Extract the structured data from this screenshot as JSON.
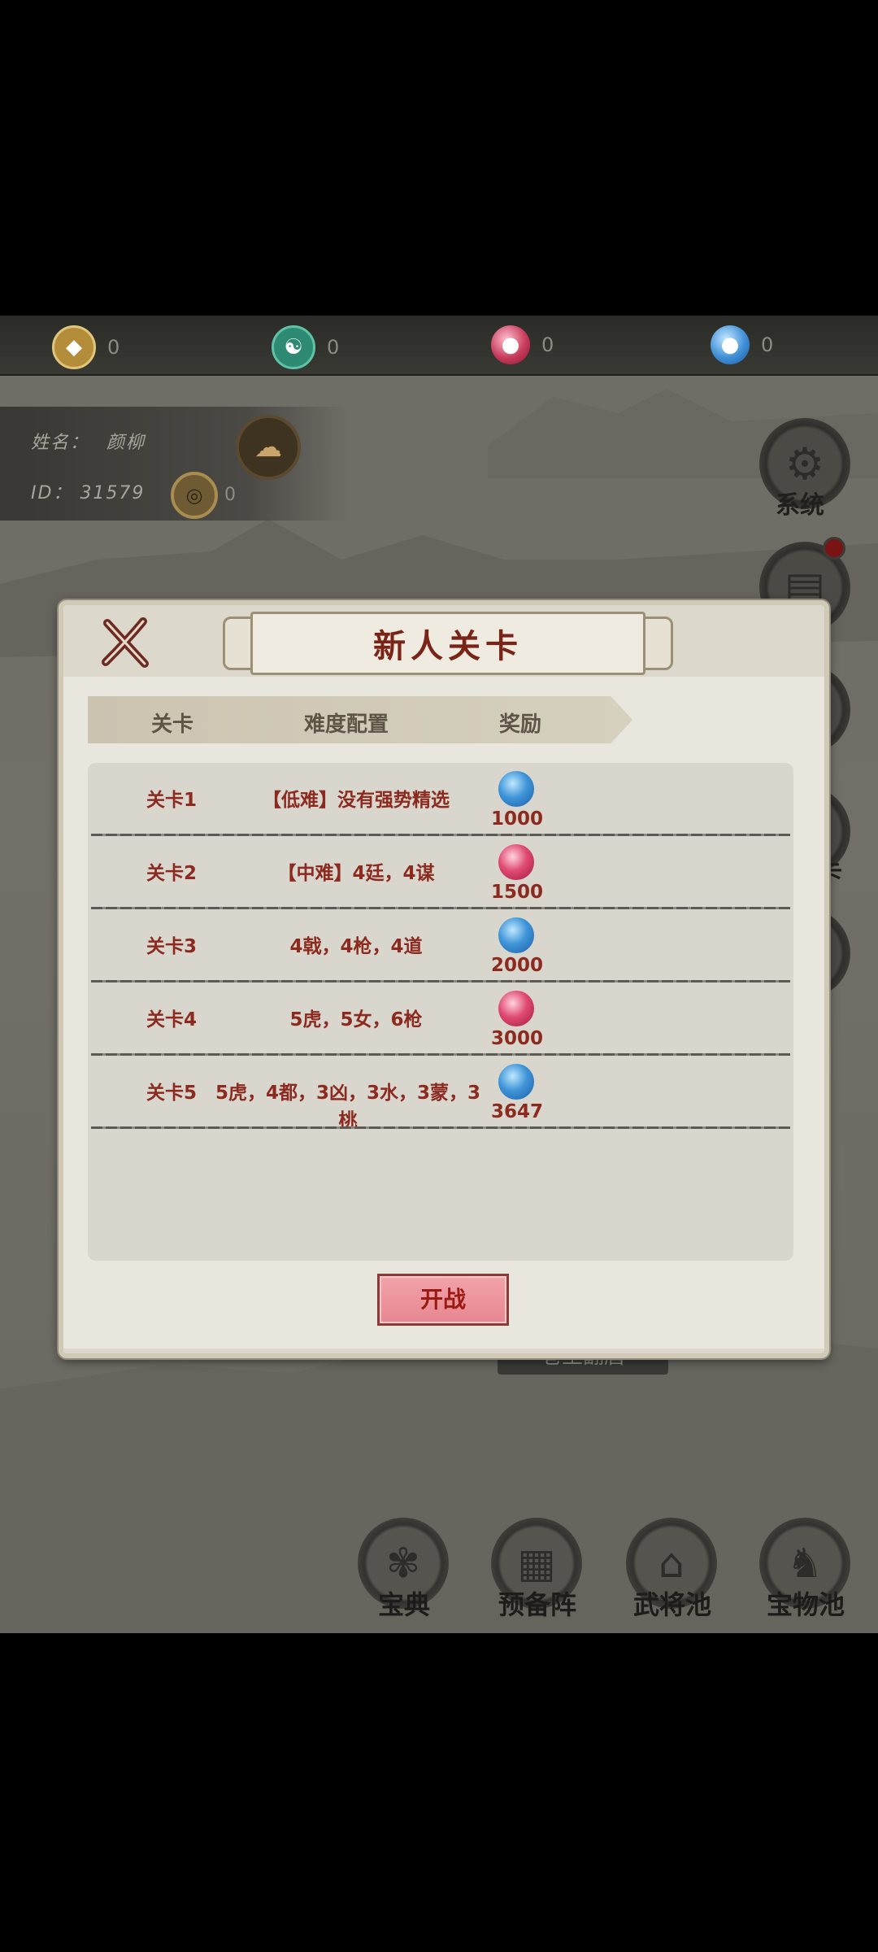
{
  "resources": [
    {
      "icon": "coin-icon",
      "value": "0",
      "color": "#caa44e"
    },
    {
      "icon": "jade-dragon-icon",
      "value": "0",
      "color": "#3e9c84"
    },
    {
      "icon": "red-orb-icon",
      "value": "0",
      "color": "#c83b5c"
    },
    {
      "icon": "blue-orb-icon",
      "value": "0",
      "color": "#3f8fd6"
    }
  ],
  "profile": {
    "name_label": "姓名：",
    "name_value": "颜柳",
    "id_label": "ID：",
    "id_value": "31579",
    "currency_value": "0"
  },
  "side_menu": [
    {
      "label": "系统",
      "icon": "gear-icon"
    },
    {
      "label": "",
      "icon": "scroll-icon"
    },
    {
      "label": "",
      "icon": "book-icon"
    },
    {
      "label": "卡",
      "icon": "card-icon"
    },
    {
      "label": "",
      "icon": "badge-icon"
    }
  ],
  "behind_banner": "巷王翻唐",
  "bottom_nav": [
    {
      "label": "宝典",
      "icon": "fan-icon"
    },
    {
      "label": "预备阵",
      "icon": "grid-icon"
    },
    {
      "label": "武将池",
      "icon": "pavilion-icon"
    },
    {
      "label": "宝物池",
      "icon": "dragon-icon"
    }
  ],
  "modal": {
    "title": "新人关卡",
    "headers": {
      "stage": "关卡",
      "config": "难度配置",
      "reward": "奖励"
    },
    "rows": [
      {
        "stage": "关卡1",
        "config": "【低难】没有强势精选",
        "reward_type": "blue",
        "reward": "1000"
      },
      {
        "stage": "关卡2",
        "config": "【中难】4廷，4谋",
        "reward_type": "red",
        "reward": "1500"
      },
      {
        "stage": "关卡3",
        "config": "4戟，4枪，4道",
        "reward_type": "blue",
        "reward": "2000"
      },
      {
        "stage": "关卡4",
        "config": "5虎，5女，6枪",
        "reward_type": "red",
        "reward": "3000"
      },
      {
        "stage": "关卡5",
        "config": "5虎，4都，3凶，3水，3蒙，3桃",
        "reward_type": "blue",
        "reward": "3647"
      }
    ],
    "start_label": "开战"
  }
}
